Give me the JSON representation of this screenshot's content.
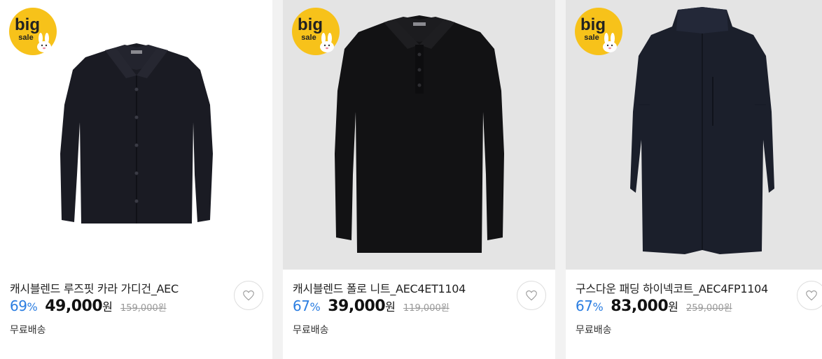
{
  "products": [
    {
      "badge": {
        "line1": "big",
        "line2": "sale"
      },
      "name": "캐시블렌드 루즈핏 카라 가디건_AEC",
      "discount": "69",
      "discount_unit": "%",
      "price": "49,000",
      "price_unit": "원",
      "original_price": "159,000원",
      "shipping": "무료배송",
      "wishlist_icon": "heart-icon",
      "image_bg": "#ffffff"
    },
    {
      "badge": {
        "line1": "big",
        "line2": "sale"
      },
      "name": "캐시블렌드 폴로 니트_AEC4ET1104",
      "discount": "67",
      "discount_unit": "%",
      "price": "39,000",
      "price_unit": "원",
      "original_price": "119,000원",
      "shipping": "무료배송",
      "wishlist_icon": "heart-icon",
      "image_bg": "#e4e4e4"
    },
    {
      "badge": {
        "line1": "big",
        "line2": "sale"
      },
      "name": "구스다운 패딩 하이넥코트_AEC4FP1104",
      "discount": "67",
      "discount_unit": "%",
      "price": "83,000",
      "price_unit": "원",
      "original_price": "259,000원",
      "shipping": "무료배송",
      "wishlist_icon": "heart-icon",
      "image_bg": "#e4e4e4"
    }
  ],
  "colors": {
    "discount": "#2a7de1",
    "badge_yellow": "#f7c21a",
    "page_bg": "#f2f2f2"
  }
}
